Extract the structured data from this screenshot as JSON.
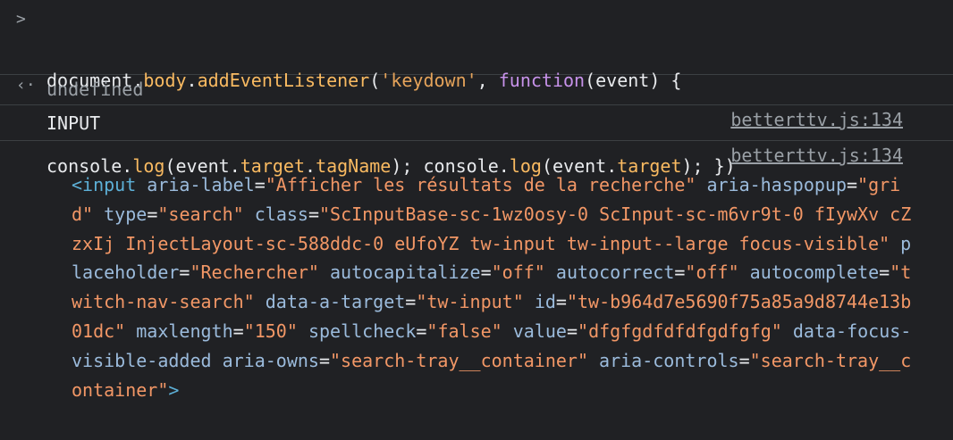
{
  "command": {
    "prompt_glyph": ">",
    "line1": {
      "obj": "document",
      "dot1": ".",
      "body": "body",
      "dot2": ".",
      "method": "addEventListener",
      "open": "(",
      "event_name": "'keydown'",
      "comma": ", ",
      "fn": "function",
      "params": "(event) {"
    },
    "line2": {
      "c1": "console",
      "d1": ".",
      "log1": "log",
      "a1": "(event",
      "d2": ".",
      "target1": "target",
      "d3": ".",
      "tagName": "tagName",
      "close1": "); ",
      "c2": "console",
      "d4": ".",
      "log2": "log",
      "a2": "(event",
      "d5": ".",
      "target2": "target",
      "close2": "); })"
    }
  },
  "result": {
    "glyph": "‹·",
    "value": "undefined"
  },
  "log1": {
    "text": "INPUT",
    "source": "betterttv.js:134"
  },
  "log2": {
    "source": "betterttv.js:134",
    "element": {
      "open": "<input",
      "attrs": [
        {
          "name": "aria-label",
          "value": "\"Afficher les résultats de la recherche\""
        },
        {
          "name": "aria-haspopup",
          "value": "\"grid\""
        },
        {
          "name": "type",
          "value": "\"search\""
        },
        {
          "name": "class",
          "value": "\"ScInputBase-sc-1wz0osy-0 ScInput-sc-m6vr9t-0 fIywXv cZzxIj InjectLayout-sc-588ddc-0 eUfoYZ tw-input tw-input--large focus-visible\""
        },
        {
          "name": "placeholder",
          "value": "\"Rechercher\""
        },
        {
          "name": "autocapitalize",
          "value": "\"off\""
        },
        {
          "name": "autocorrect",
          "value": "\"off\""
        },
        {
          "name": "autocomplete",
          "value": "\"twitch-nav-search\""
        },
        {
          "name": "data-a-target",
          "value": "\"tw-input\""
        },
        {
          "name": "id",
          "value": "\"tw-b964d7e5690f75a85a9d8744e13b01dc\""
        },
        {
          "name": "maxlength",
          "value": "\"150\""
        },
        {
          "name": "spellcheck",
          "value": "\"false\""
        },
        {
          "name": "value",
          "value": "\"dfgfgdfdfdfgdfgfg\""
        },
        {
          "name": "data-focus-visible-added",
          "value": ""
        },
        {
          "name": "aria-owns",
          "value": "\"search-tray__container\""
        },
        {
          "name": "aria-controls",
          "value": "\"search-tray__container\""
        }
      ],
      "close": ">"
    }
  },
  "colors": {
    "background": "#202124",
    "separator": "#3c4043",
    "keyword": "#c792ea",
    "property": "#f9ba61",
    "string": "#e5a35a",
    "tag": "#5db0d7",
    "attribute": "#9bbbdc",
    "attribute_value": "#f29766"
  }
}
